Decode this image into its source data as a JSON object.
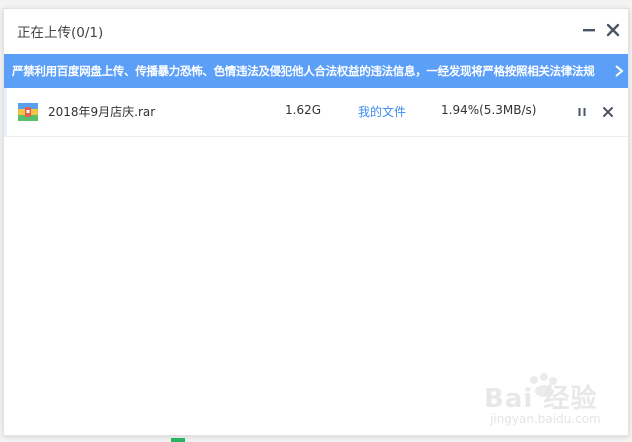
{
  "window": {
    "title": "正在上传(0/1)"
  },
  "banner": {
    "text": "严禁利用百度网盘上传、传播暴力恐怖、色情违法及侵犯他人合法权益的违法信息，一经发现将严格按照相关法律法规"
  },
  "tasks": [
    {
      "filename": "2018年9月店庆.rar",
      "size": "1.62G",
      "destination": "我的文件",
      "progress": "1.94%(5.3MB/s)"
    }
  ],
  "watermark": {
    "text": "Bai 经验",
    "sub": "jingyan.baidu.com"
  },
  "colors": {
    "banner_bg": "#5b9ff8",
    "link": "#3b8cf0",
    "icon_dark": "#4a5566"
  }
}
